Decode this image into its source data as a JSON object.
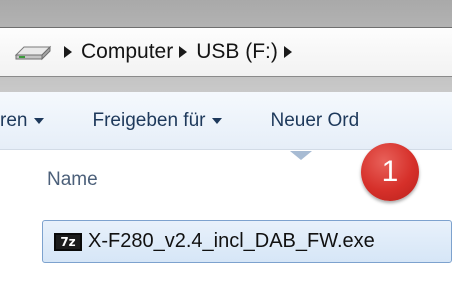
{
  "address_bar": {
    "icon": "drive-icon",
    "breadcrumbs": [
      "Computer",
      "USB (F:)"
    ]
  },
  "toolbar": {
    "items": [
      {
        "label": "ren"
      },
      {
        "label": "Freigeben für"
      },
      {
        "label": "Neuer Ord"
      }
    ]
  },
  "file_list": {
    "column_name": "Name",
    "files": [
      {
        "icon": "7z-archive-icon",
        "icon_text": "7z",
        "name": "X-F280_v2.4_incl_DAB_FW.exe",
        "selected": true
      }
    ]
  },
  "badge": {
    "label": "1",
    "color": "#d6302a"
  },
  "colors": {
    "selection": "#d6e6f7",
    "toolbar": "#e6eef8",
    "accent_text": "#1e395b"
  }
}
